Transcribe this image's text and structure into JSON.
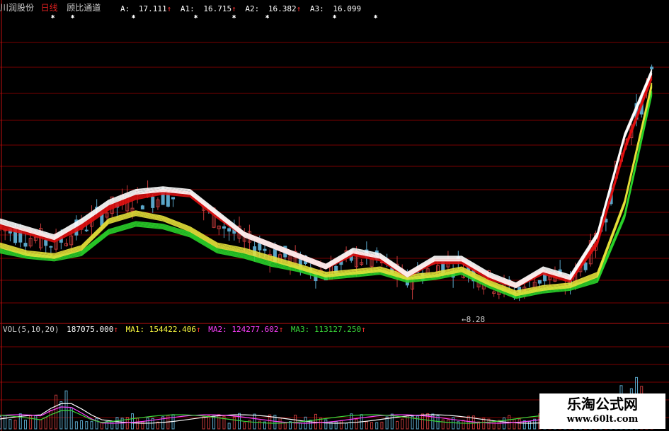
{
  "colors": {
    "background": "#000000",
    "grid": "#7a0000",
    "candle_up": "#c23a3a",
    "candle_down": "#5aa6c8",
    "A": "#ffffff",
    "A1_up": "#e01010",
    "A2": "#e6e23a",
    "A3": "#2ad42a",
    "vol_ma1": "#ffffff",
    "vol_ma2": "#ff40ff",
    "vol_ma3": "#3adc3a"
  },
  "header": {
    "stock_name": "川润股份",
    "period": "日线",
    "indicator": "顾比通道",
    "items": [
      {
        "label": "A:",
        "value": "17.111",
        "arrow": "↑"
      },
      {
        "label": "A1:",
        "value": "16.715",
        "arrow": "↑"
      },
      {
        "label": "A2:",
        "value": "16.382",
        "arrow": "↑"
      },
      {
        "label": "A3:",
        "value": "16.099",
        "arrow": ""
      }
    ]
  },
  "vol_header": {
    "name": "VOL(5,10,20)",
    "vol": "187075.000",
    "vol_arrow": "↑",
    "ma1_label": "MA1:",
    "ma1": "154422.406",
    "ma1_arrow": "↑",
    "ma2_label": "MA2:",
    "ma2": "124277.602",
    "ma2_arrow": "↑",
    "ma3_label": "MA3:",
    "ma3": "113127.250",
    "ma3_arrow": "↑"
  },
  "annotation": {
    "low_label": "8.28"
  },
  "watermark": {
    "title": "乐淘公式网",
    "url": "www.60lt.com"
  },
  "chart_data": {
    "type": "line",
    "title": "",
    "xlabel": "",
    "ylabel": "",
    "ylim": [
      7.5,
      19.0
    ],
    "grid": true,
    "legend": "top-left",
    "series": [
      {
        "name": "A",
        "x": [
          0,
          8,
          16,
          24,
          32,
          40,
          48,
          56,
          64,
          72,
          80,
          88,
          96,
          104,
          112,
          120,
          128,
          136,
          144,
          152,
          160,
          168,
          176,
          184,
          192
        ],
        "values": [
          11.3,
          11.0,
          10.7,
          11.3,
          12.0,
          12.4,
          12.5,
          12.4,
          11.6,
          10.8,
          10.4,
          10.0,
          9.6,
          10.2,
          10.0,
          9.3,
          9.9,
          9.9,
          9.3,
          8.9,
          9.5,
          9.2,
          10.8,
          14.5,
          16.9
        ]
      },
      {
        "name": "A1",
        "x": [
          0,
          8,
          16,
          24,
          32,
          40,
          48,
          56,
          64,
          72,
          80,
          88,
          96,
          104,
          112,
          120,
          128,
          136,
          144,
          152,
          160,
          168,
          176,
          184,
          192
        ],
        "values": [
          11.1,
          10.9,
          10.6,
          11.1,
          11.8,
          12.2,
          12.4,
          12.3,
          11.5,
          10.8,
          10.4,
          10.0,
          9.6,
          10.1,
          9.9,
          9.3,
          9.8,
          9.8,
          9.2,
          8.9,
          9.4,
          9.1,
          10.5,
          14.0,
          16.7
        ]
      },
      {
        "name": "A2",
        "x": [
          0,
          8,
          16,
          24,
          32,
          40,
          48,
          56,
          64,
          72,
          80,
          88,
          96,
          104,
          112,
          120,
          128,
          136,
          144,
          152,
          160,
          168,
          176,
          184,
          192
        ],
        "values": [
          10.4,
          10.1,
          10.0,
          10.3,
          11.3,
          11.6,
          11.4,
          11.0,
          10.4,
          10.2,
          9.9,
          9.6,
          9.3,
          9.4,
          9.5,
          9.2,
          9.3,
          9.5,
          9.0,
          8.6,
          8.8,
          8.9,
          9.3,
          12.0,
          16.4
        ]
      },
      {
        "name": "A3",
        "x": [
          0,
          8,
          16,
          24,
          32,
          40,
          48,
          56,
          64,
          72,
          80,
          88,
          96,
          104,
          112,
          120,
          128,
          136,
          144,
          152,
          160,
          168,
          176,
          184,
          192
        ],
        "values": [
          10.2,
          10.0,
          9.9,
          10.1,
          10.9,
          11.2,
          11.1,
          10.8,
          10.2,
          10.0,
          9.7,
          9.5,
          9.2,
          9.3,
          9.4,
          9.1,
          9.2,
          9.4,
          8.9,
          8.5,
          8.7,
          8.8,
          9.1,
          11.5,
          16.1
        ]
      }
    ],
    "volume": {
      "ma1": 154422.406,
      "ma2": 124277.602,
      "ma3": 113127.25,
      "last": 187075.0
    },
    "low_mark": 8.28
  }
}
